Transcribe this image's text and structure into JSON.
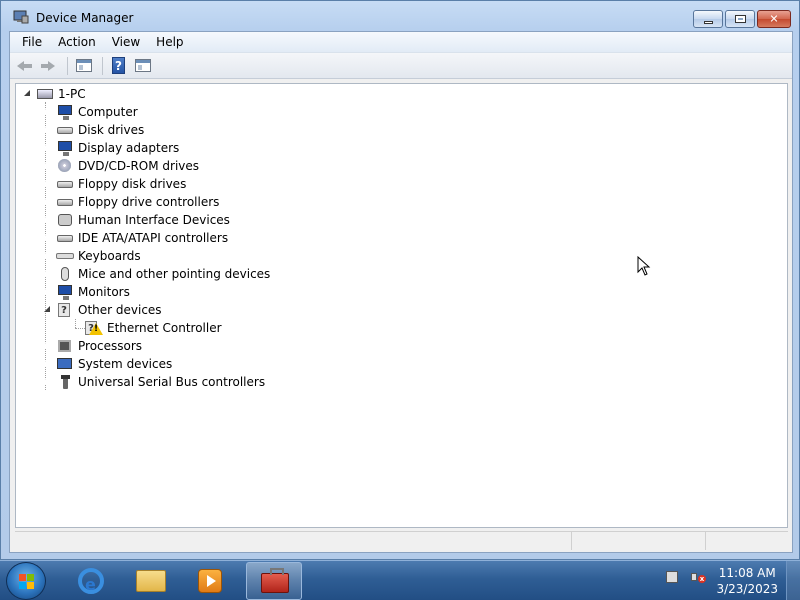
{
  "window": {
    "title": "Device Manager",
    "caption_buttons": [
      "minimize",
      "maximize",
      "close"
    ]
  },
  "menu": [
    "File",
    "Action",
    "View",
    "Help"
  ],
  "toolbar": {
    "buttons": [
      "back-arrow-icon",
      "forward-arrow-icon",
      "show-hide-console-tree-icon",
      "help-icon",
      "properties-pane-icon"
    ]
  },
  "tree": {
    "root": "1-PC",
    "categories": [
      {
        "label": "Computer",
        "icon": "computer-icon",
        "expanded": false
      },
      {
        "label": "Disk drives",
        "icon": "disk-drive-icon",
        "expanded": false
      },
      {
        "label": "Display adapters",
        "icon": "display-adapter-icon",
        "expanded": false
      },
      {
        "label": "DVD/CD-ROM drives",
        "icon": "dvd-drive-icon",
        "expanded": false
      },
      {
        "label": "Floppy disk drives",
        "icon": "floppy-disk-icon",
        "expanded": false
      },
      {
        "label": "Floppy drive controllers",
        "icon": "floppy-controller-icon",
        "expanded": false
      },
      {
        "label": "Human Interface Devices",
        "icon": "hid-icon",
        "expanded": false
      },
      {
        "label": "IDE ATA/ATAPI controllers",
        "icon": "ide-controller-icon",
        "expanded": false
      },
      {
        "label": "Keyboards",
        "icon": "keyboard-icon",
        "expanded": false
      },
      {
        "label": "Mice and other pointing devices",
        "icon": "mouse-icon",
        "expanded": false
      },
      {
        "label": "Monitors",
        "icon": "monitor-icon",
        "expanded": false
      },
      {
        "label": "Other devices",
        "icon": "unknown-device-icon",
        "expanded": true,
        "children": [
          {
            "label": "Ethernet Controller",
            "icon": "warning-device-icon"
          }
        ]
      },
      {
        "label": "Processors",
        "icon": "processor-icon",
        "expanded": false
      },
      {
        "label": "System devices",
        "icon": "system-device-icon",
        "expanded": false
      },
      {
        "label": "Universal Serial Bus controllers",
        "icon": "usb-icon",
        "expanded": false
      }
    ]
  },
  "taskbar": {
    "apps": [
      "internet-explorer-icon",
      "windows-explorer-icon",
      "media-player-icon",
      "device-manager-toolbox-icon"
    ],
    "active_app": "device-manager-toolbox-icon",
    "clock_time": "11:08 AM",
    "clock_date": "3/23/2023"
  }
}
